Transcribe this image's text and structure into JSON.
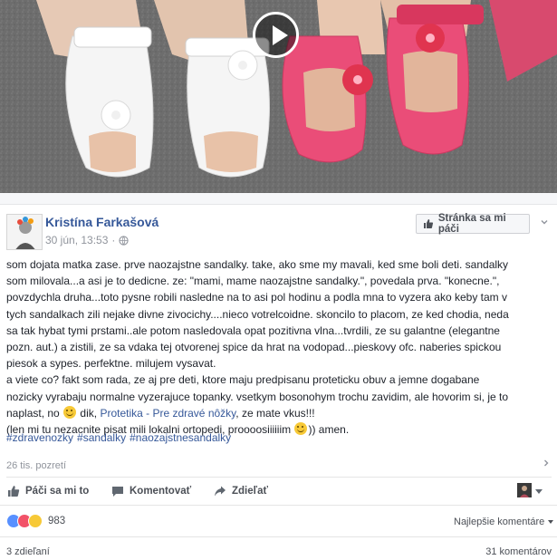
{
  "video": {
    "play_icon": "play-icon"
  },
  "post": {
    "author": "Kristína Farkašová",
    "date": "30 jún, 13:53",
    "separator": "·",
    "privacy_icon": "globe-icon",
    "like_page_button": "Stránka sa mi páči",
    "lines": [
      "som dojata matka zase. prve naozajstne sandalky. take, ako sme my mavali, ked sme boli deti. sandalky",
      "som milovala...a asi je to dedicne. ze: \"mami, mame naozajstne sandalky.\", povedala prva. \"konecne.\",",
      "povzdychla druha...toto pysne robili nasledne na to asi pol hodinu a podla mna to vyzera ako keby tam v",
      "tych sandalkach zili nejake divne zivocichy....nieco votrelcoidne. skoncilo to placom, ze ked chodia, neda",
      "sa tak hybat tymi prstami..ale potom nasledovala opat pozitivna vlna...tvrdili, ze su galantne (elegantne",
      "pozn. aut.) a zistili, ze sa vdaka tej otvorenej spice da hrat na vodopad...pieskovy ofc. naberies spickou",
      "piesok a sypes. perfektne. milujem vysavat.",
      "a viete co? fakt som rada, ze aj pre deti, ktore maju predpisanu proteticku obuv a jemne dogabane",
      "nozicky vyrabaju normalne vyzerajuce topanky. vsetkym bosonohym trochu zavidim, ale hovorim si, je to"
    ],
    "line10_pre": "naplast, no",
    "line10_mid": "dik,",
    "line10_link": "Protetika - Pre zdravé nôžky",
    "line10_post": ", ze mate vkus!!!",
    "line11_pre": "(len mi tu nezacnite pisat mili lokalni ortopedi, proooosiiiiiim",
    "line11_post": ")) amen.",
    "hashtags": [
      "#zdravenozky",
      "#sandalky",
      "#naozajstnesandalky"
    ],
    "views": "26 tis. pozretí"
  },
  "actions": {
    "like": "Páči sa mi to",
    "comment": "Komentovať",
    "share": "Zdieľať"
  },
  "reactions": {
    "count": "983",
    "types": [
      "like",
      "love",
      "haha"
    ],
    "sort": "Najlepšie komentáre"
  },
  "footer": {
    "shares": "3 zdieľaní",
    "comments": "31 komentárov"
  }
}
